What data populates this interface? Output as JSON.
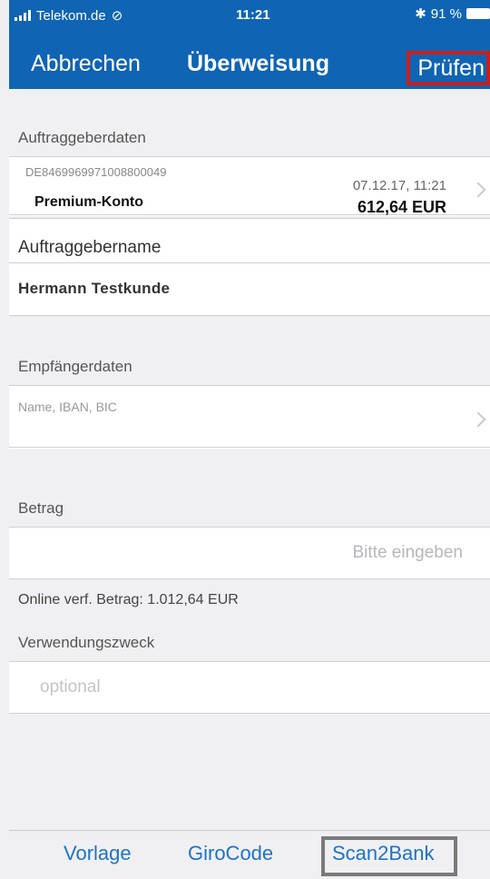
{
  "status_bar": {
    "carrier": "Telekom.de",
    "time": "11:21",
    "battery": "91 %"
  },
  "nav": {
    "cancel_label": "Abbrechen",
    "title": "Überweisung",
    "check_label": "Prüfen"
  },
  "sender": {
    "section_label": "Auftraggeberdaten",
    "iban": "DE8469969971008800049",
    "account_name": "Premium-Konto",
    "date_time": "07.12.17, 11:21",
    "balance": "612,64 EUR",
    "name_label": "Auftraggebername",
    "name_value": "Hermann Testkunde"
  },
  "recipient": {
    "section_label": "Empfängerdaten",
    "field_placeholder": "Name, IBAN, BIC"
  },
  "amount": {
    "section_label": "Betrag",
    "placeholder": "Bitte eingeben",
    "online_verified": "Online verf. Betrag: 1.012,64 EUR"
  },
  "purpose": {
    "section_label": "Verwendungszweck",
    "placeholder": "optional"
  },
  "bottom_bar": {
    "items": [
      "Vorlage",
      "GiroCode",
      "Scan2Bank"
    ]
  },
  "colors": {
    "nav_background": "#0f64b4",
    "check_highlight": "#c81e1e",
    "scan_highlight": "#7a7a7a",
    "link_blue": "#1e73c8"
  }
}
